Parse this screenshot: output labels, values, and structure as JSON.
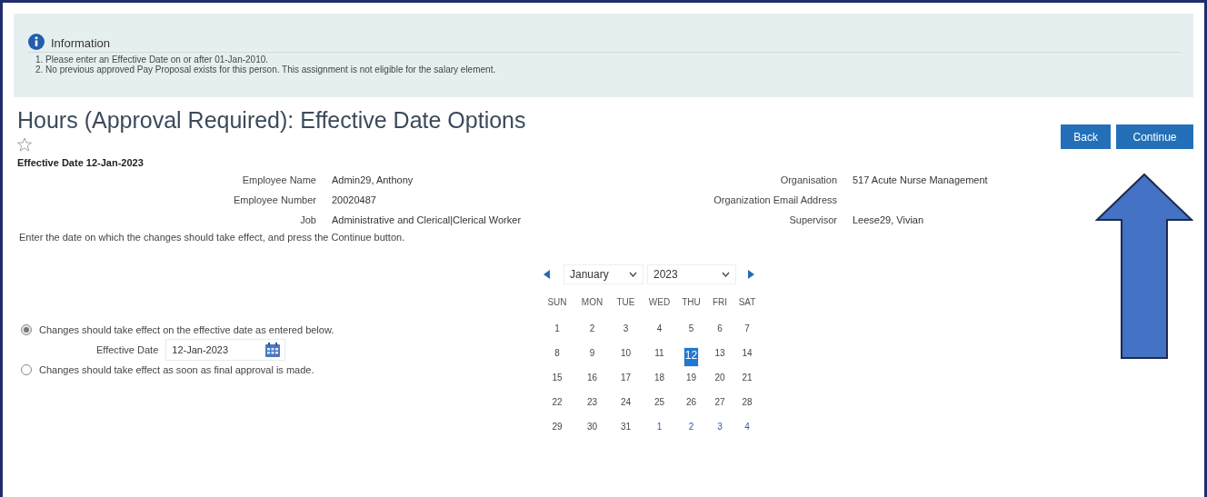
{
  "info": {
    "title": "Information",
    "messages": [
      "1. Please enter an Effective Date on or after 01-Jan-2010.",
      "2. No previous approved Pay Proposal exists for this person. This assignment is not eligible for the salary element."
    ]
  },
  "page": {
    "title": "Hours (Approval Required): Effective Date Options",
    "favorite": false,
    "effective_date": "Effective Date 12-Jan-2023"
  },
  "buttons": [
    "Back",
    "Continue"
  ],
  "details_left": [
    {
      "label": "Employee Name",
      "value": "Admin29, Anthony"
    },
    {
      "label": "Employee Number",
      "value": "20020487"
    },
    {
      "label": "Job",
      "value": "Administrative and Clerical|Clerical Worker"
    }
  ],
  "details_right": [
    {
      "label": "Organisation",
      "value": "517 Acute Nurse Management"
    },
    {
      "label": "Organization Email Address"
    },
    {
      "label": "Supervisor",
      "value": "Leese29, Vivian"
    }
  ],
  "instruction": "Enter the date on which the changes should take effect, and press the Continue button.",
  "options": [
    {
      "label": "Changes should take effect on the effective date as entered below.",
      "selected": true
    },
    {
      "label": "Changes should take effect as soon as final approval is made.",
      "selected": false
    }
  ],
  "effective_date_field": {
    "label": "Effective Date",
    "value": "12-Jan-2023"
  },
  "calendar": {
    "month": "January",
    "year": "2023",
    "weekdays": [
      "SUN",
      "MON",
      "TUE",
      "WED",
      "THU",
      "FRI",
      "SAT"
    ],
    "days": [
      {
        "label": "1",
        "selected": false,
        "adjacent": false
      },
      {
        "label": "2",
        "selected": false,
        "adjacent": false
      },
      {
        "label": "3",
        "selected": false,
        "adjacent": false
      },
      {
        "label": "4",
        "selected": false,
        "adjacent": false
      },
      {
        "label": "5",
        "selected": false,
        "adjacent": false
      },
      {
        "label": "6",
        "selected": false,
        "adjacent": false
      },
      {
        "label": "7",
        "selected": false,
        "adjacent": false
      },
      {
        "label": "8",
        "selected": false,
        "adjacent": false
      },
      {
        "label": "9",
        "selected": false,
        "adjacent": false
      },
      {
        "label": "10",
        "selected": false,
        "adjacent": false
      },
      {
        "label": "11",
        "selected": false,
        "adjacent": false
      },
      {
        "label": "12",
        "selected": true,
        "adjacent": false
      },
      {
        "label": "13",
        "selected": false,
        "adjacent": false
      },
      {
        "label": "14",
        "selected": false,
        "adjacent": false
      },
      {
        "label": "15",
        "selected": false,
        "adjacent": false
      },
      {
        "label": "16",
        "selected": false,
        "adjacent": false
      },
      {
        "label": "17",
        "selected": false,
        "adjacent": false
      },
      {
        "label": "18",
        "selected": false,
        "adjacent": false
      },
      {
        "label": "19",
        "selected": false,
        "adjacent": false
      },
      {
        "label": "20",
        "selected": false,
        "adjacent": false
      },
      {
        "label": "21",
        "selected": false,
        "adjacent": false
      },
      {
        "label": "22",
        "selected": false,
        "adjacent": false
      },
      {
        "label": "23",
        "selected": false,
        "adjacent": false
      },
      {
        "label": "24",
        "selected": false,
        "adjacent": false
      },
      {
        "label": "25",
        "selected": false,
        "adjacent": false
      },
      {
        "label": "26",
        "selected": false,
        "adjacent": false
      },
      {
        "label": "27",
        "selected": false,
        "adjacent": false
      },
      {
        "label": "28",
        "selected": false,
        "adjacent": false
      },
      {
        "label": "29",
        "selected": false,
        "adjacent": false
      },
      {
        "label": "30",
        "selected": false,
        "adjacent": false
      },
      {
        "label": "31",
        "selected": false,
        "adjacent": false
      },
      {
        "label": "1",
        "selected": false,
        "adjacent": true
      },
      {
        "label": "2",
        "selected": false,
        "adjacent": true
      },
      {
        "label": "3",
        "selected": false,
        "adjacent": true
      },
      {
        "label": "4",
        "selected": false,
        "adjacent": true
      }
    ]
  }
}
